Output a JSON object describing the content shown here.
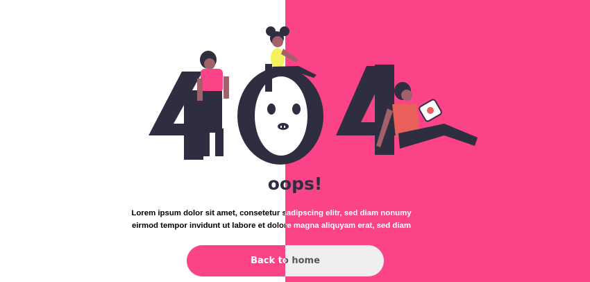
{
  "error_code_display": "404",
  "heading": "oops!",
  "message": "Lorem ipsum dolor sit amet, consetetur sadipscing elitr, sed diam nonumy eirmod tempor invidunt ut labore et dolore magna aliquyam erat, sed diam",
  "back_button_label": "Back to home",
  "colors": {
    "accent": "#fb4387",
    "dark": "#2f2e41",
    "background": "#ffffff"
  }
}
